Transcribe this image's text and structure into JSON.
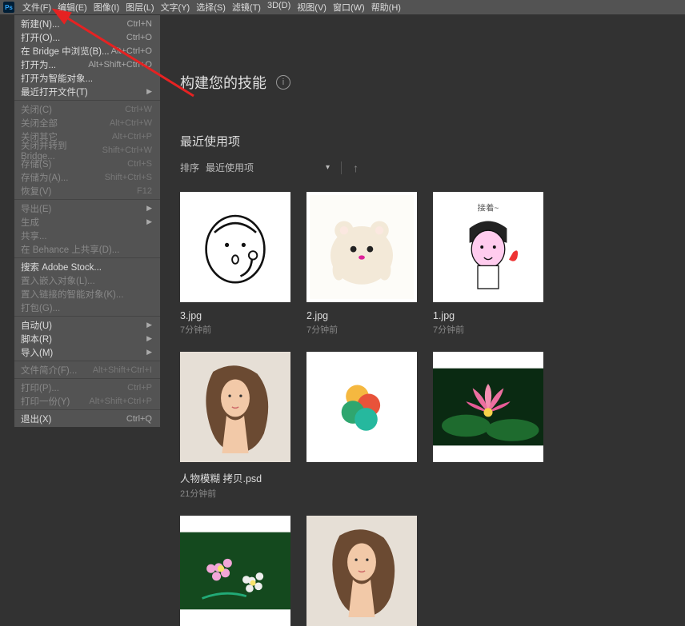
{
  "menubar": {
    "items": [
      "文件(F)",
      "编辑(E)",
      "图像(I)",
      "图层(L)",
      "文字(Y)",
      "选择(S)",
      "滤镜(T)",
      "3D(D)",
      "视图(V)",
      "窗口(W)",
      "帮助(H)"
    ]
  },
  "file_menu": [
    {
      "type": "item",
      "label": "新建(N)...",
      "shortcut": "Ctrl+N"
    },
    {
      "type": "item",
      "label": "打开(O)...",
      "shortcut": "Ctrl+O"
    },
    {
      "type": "item",
      "label": "在 Bridge 中浏览(B)...",
      "shortcut": "Alt+Ctrl+O"
    },
    {
      "type": "item",
      "label": "打开为...",
      "shortcut": "Alt+Shift+Ctrl+O"
    },
    {
      "type": "item",
      "label": "打开为智能对象..."
    },
    {
      "type": "sub",
      "label": "最近打开文件(T)"
    },
    {
      "type": "sep"
    },
    {
      "type": "item",
      "label": "关闭(C)",
      "shortcut": "Ctrl+W",
      "disabled": true
    },
    {
      "type": "item",
      "label": "关闭全部",
      "shortcut": "Alt+Ctrl+W",
      "disabled": true
    },
    {
      "type": "item",
      "label": "关闭其它",
      "shortcut": "Alt+Ctrl+P",
      "disabled": true
    },
    {
      "type": "item",
      "label": "关闭并转到 Bridge...",
      "shortcut": "Shift+Ctrl+W",
      "disabled": true
    },
    {
      "type": "item",
      "label": "存储(S)",
      "shortcut": "Ctrl+S",
      "disabled": true
    },
    {
      "type": "item",
      "label": "存储为(A)...",
      "shortcut": "Shift+Ctrl+S",
      "disabled": true
    },
    {
      "type": "item",
      "label": "恢复(V)",
      "shortcut": "F12",
      "disabled": true
    },
    {
      "type": "sep"
    },
    {
      "type": "sub",
      "label": "导出(E)",
      "disabled": true
    },
    {
      "type": "sub",
      "label": "生成",
      "disabled": true
    },
    {
      "type": "item",
      "label": "共享...",
      "disabled": true
    },
    {
      "type": "item",
      "label": "在 Behance 上共享(D)...",
      "disabled": true
    },
    {
      "type": "sep"
    },
    {
      "type": "item",
      "label": "搜索 Adobe Stock..."
    },
    {
      "type": "item",
      "label": "置入嵌入对象(L)...",
      "disabled": true
    },
    {
      "type": "item",
      "label": "置入链接的智能对象(K)...",
      "disabled": true
    },
    {
      "type": "item",
      "label": "打包(G)...",
      "disabled": true
    },
    {
      "type": "sep"
    },
    {
      "type": "sub",
      "label": "自动(U)"
    },
    {
      "type": "sub",
      "label": "脚本(R)"
    },
    {
      "type": "sub",
      "label": "导入(M)"
    },
    {
      "type": "sep"
    },
    {
      "type": "item",
      "label": "文件简介(F)...",
      "shortcut": "Alt+Shift+Ctrl+I",
      "disabled": true
    },
    {
      "type": "sep"
    },
    {
      "type": "item",
      "label": "打印(P)...",
      "shortcut": "Ctrl+P",
      "disabled": true
    },
    {
      "type": "item",
      "label": "打印一份(Y)",
      "shortcut": "Alt+Shift+Ctrl+P",
      "disabled": true
    },
    {
      "type": "sep"
    },
    {
      "type": "item",
      "label": "退出(X)",
      "shortcut": "Ctrl+Q"
    }
  ],
  "main": {
    "heading": "构建您的技能",
    "section_title": "最近使用项",
    "sort_label": "排序",
    "sort_value": "最近使用项",
    "thumbs": [
      {
        "name": "3.jpg",
        "time": "7分钟前",
        "kind": "face"
      },
      {
        "name": "2.jpg",
        "time": "7分钟前",
        "kind": "hamster"
      },
      {
        "name": "1.jpg",
        "time": "7分钟前",
        "kind": "girl"
      },
      {
        "name": "人物模糊 拷贝.psd",
        "time": "21分钟前",
        "kind": "woman"
      },
      {
        "name": "",
        "time": "",
        "kind": "petals"
      },
      {
        "name": "",
        "time": "",
        "kind": "lotus"
      },
      {
        "name": "",
        "time": "",
        "kind": "flower"
      },
      {
        "name": "",
        "time": "",
        "kind": "woman"
      }
    ]
  }
}
